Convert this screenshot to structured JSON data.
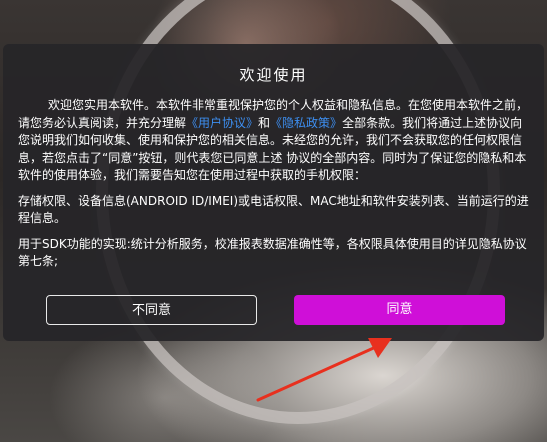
{
  "dialog": {
    "title": "欢迎使用",
    "para1_a": "欢迎您实用本软件。本软件非常重视保护您的个人权益和隐私信息。在您使用本软件之前，请您务必认真阅读，并充分理解",
    "user_agreement_link": "《用户协议》",
    "para1_and": "和",
    "privacy_policy_link": "《隐私政策》",
    "para1_b": "全部条款。我们将通过上述协议向您说明我们如何收集、使用和保护您的相关信息。未经您的允许，我们不会获取您的任何权限信息，若您点击了“同意”按钮，则代表您已同意上述 协议的全部内容。同时为了保证您的隐私和本软件的使用体验，我们需要告知您在使用过程中获取的手机权限：",
    "para2": "存储权限、设备信息(ANDROID ID/IMEI)或电话权限、MAC地址和软件安装列表、当前运行的进程信息。",
    "para3": "用于SDK功能的实现:统计分析服务，校准报表数据准确性等，各权限具体使用目的详见隐私协议第七条;",
    "decline_label": "不同意",
    "agree_label": "同意"
  },
  "colors": {
    "link": "#3d8ef0",
    "agree_button": "#cf0fd8",
    "annotation_arrow": "#e8301e"
  }
}
